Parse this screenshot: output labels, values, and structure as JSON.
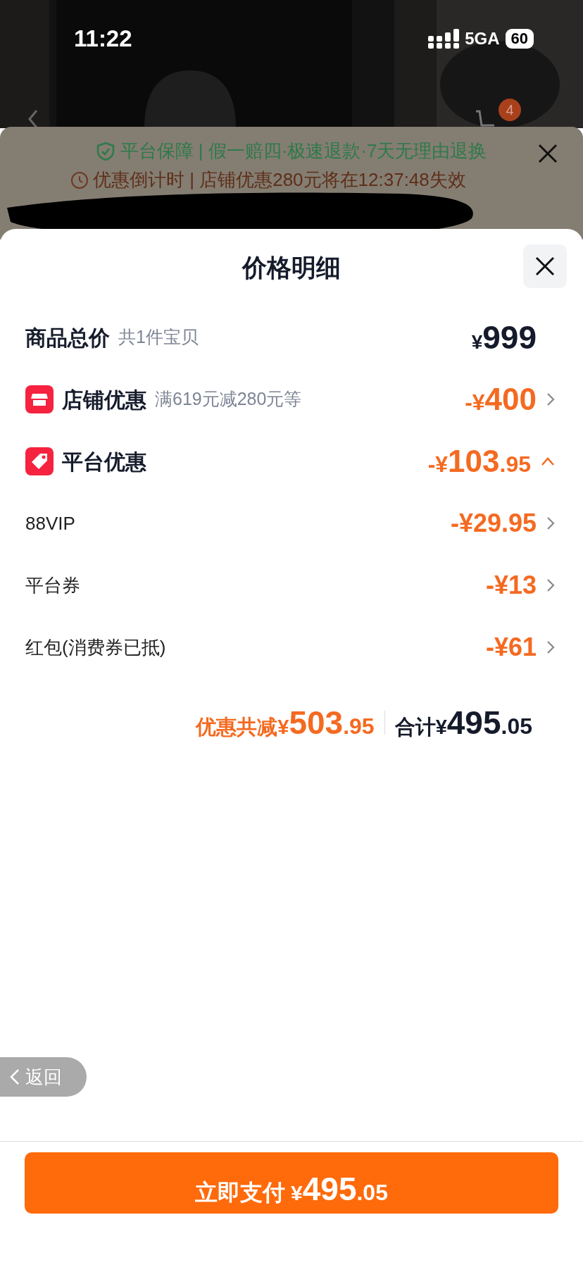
{
  "status_bar": {
    "time": "11:22",
    "network": "5GA",
    "battery": "60"
  },
  "background_page": {
    "cart_badge": "4",
    "guarantee": "平台保障 | 假一赔四·极速退款·7天无理由退换",
    "countdown": "优惠倒计时 | 店铺优惠280元将在12:37:48失效"
  },
  "sheet": {
    "title": "价格明细",
    "rows": [
      {
        "kind": "total",
        "label": "商品总价",
        "note": "共1件宝贝",
        "prefix": "¥",
        "integer": "999",
        "fraction": ""
      },
      {
        "kind": "discount",
        "label": "店铺优惠",
        "note": "满619元减280元等",
        "prefix": "-¥",
        "integer": "400",
        "fraction": "",
        "expanded": false
      },
      {
        "kind": "discount",
        "label": "平台优惠",
        "prefix": "-¥",
        "integer": "103",
        "fraction": ".95",
        "expanded": true
      },
      {
        "kind": "sub",
        "label": "88VIP",
        "prefix": "-¥",
        "integer": "29.95",
        "fraction": ""
      },
      {
        "kind": "sub",
        "label": "平台券",
        "prefix": "-¥",
        "integer": "13",
        "fraction": ""
      },
      {
        "kind": "sub",
        "label": "红包(消费券已抵)",
        "prefix": "-¥",
        "integer": "61",
        "fraction": ""
      }
    ],
    "summary": {
      "saved_label": "优惠共减¥",
      "saved_integer": "503",
      "saved_fraction": ".95",
      "total_label": "合计¥",
      "total_integer": "495",
      "total_fraction": ".05"
    }
  },
  "back_button": {
    "label": "返回"
  },
  "pay_button": {
    "label": "立即支付",
    "prefix": "¥",
    "integer": "495",
    "fraction": ".05"
  }
}
